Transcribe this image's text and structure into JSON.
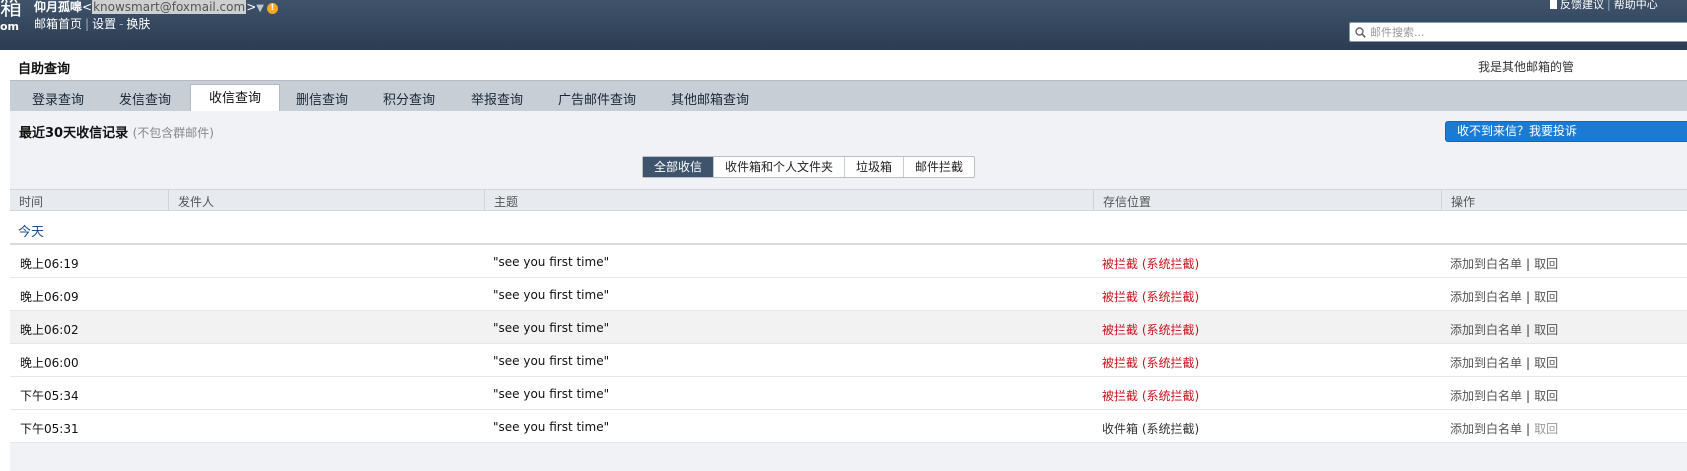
{
  "header": {
    "logo_char": "箱",
    "logo_sub": "om",
    "username": "仰月孤嗥",
    "email": "knowsmart@foxmail.com",
    "lt": "<",
    "gt": ">",
    "arrow": "▼",
    "warn": "!",
    "links": [
      "邮箱首页",
      "设置",
      "换肤"
    ],
    "top_right": [
      "反馈建议",
      "帮助中心"
    ],
    "search_placeholder": "邮件搜索..."
  },
  "page": {
    "self_query_title": "自助查询",
    "other_admin": "我是其他邮箱的管",
    "tabs": [
      {
        "label": "登录查询",
        "active": false
      },
      {
        "label": "发信查询",
        "active": false
      },
      {
        "label": "收信查询",
        "active": true
      },
      {
        "label": "删信查询",
        "active": false
      },
      {
        "label": "积分查询",
        "active": false
      },
      {
        "label": "举报查询",
        "active": false
      },
      {
        "label": "广告邮件查询",
        "active": false
      },
      {
        "label": "其他邮箱查询",
        "active": false
      }
    ],
    "section_title": "最近30天收信记录",
    "section_note": "(不包含群邮件)",
    "complain_button": "收不到来信？我要投诉",
    "filters": [
      {
        "label": "全部收信",
        "active": true
      },
      {
        "label": "收件箱和个人文件夹",
        "active": false
      },
      {
        "label": "垃圾箱",
        "active": false
      },
      {
        "label": "邮件拦截",
        "active": false
      }
    ]
  },
  "table": {
    "columns": [
      "时间",
      "发件人",
      "主题",
      "存信位置",
      "操作"
    ],
    "group_label": "今天",
    "rows": [
      {
        "time": "晚上06:19",
        "sender": "",
        "subject": "\"see you first time\"",
        "location": "被拦截 (系统拦截)",
        "status": "blocked"
      },
      {
        "time": "晚上06:09",
        "sender": "",
        "subject": "\"see you first time\"",
        "location": "被拦截 (系统拦截)",
        "status": "blocked"
      },
      {
        "time": "晚上06:02",
        "sender": "",
        "subject": "\"see you first time\"",
        "location": "被拦截 (系统拦截)",
        "status": "blocked"
      },
      {
        "time": "晚上06:00",
        "sender": "",
        "subject": "\"see you first time\"",
        "location": "被拦截 (系统拦截)",
        "status": "blocked"
      },
      {
        "time": "下午05:34",
        "sender": "",
        "subject": "\"see you first time\"",
        "location": "被拦截 (系统拦截)",
        "status": "blocked"
      },
      {
        "time": "下午05:31",
        "sender": "",
        "subject": "\"see you first time\"",
        "location": "收件箱 (系统拦截)",
        "status": "inbox"
      }
    ],
    "op_whitelist": "添加到白名单",
    "op_separator": "|",
    "op_retrieve": "取回"
  },
  "colors": {
    "header_bg": "#2c3d52",
    "blocked_text": "#c8141e",
    "active_filter_bg": "#3e536c",
    "complain_button_bg": "#1b7bd3"
  }
}
